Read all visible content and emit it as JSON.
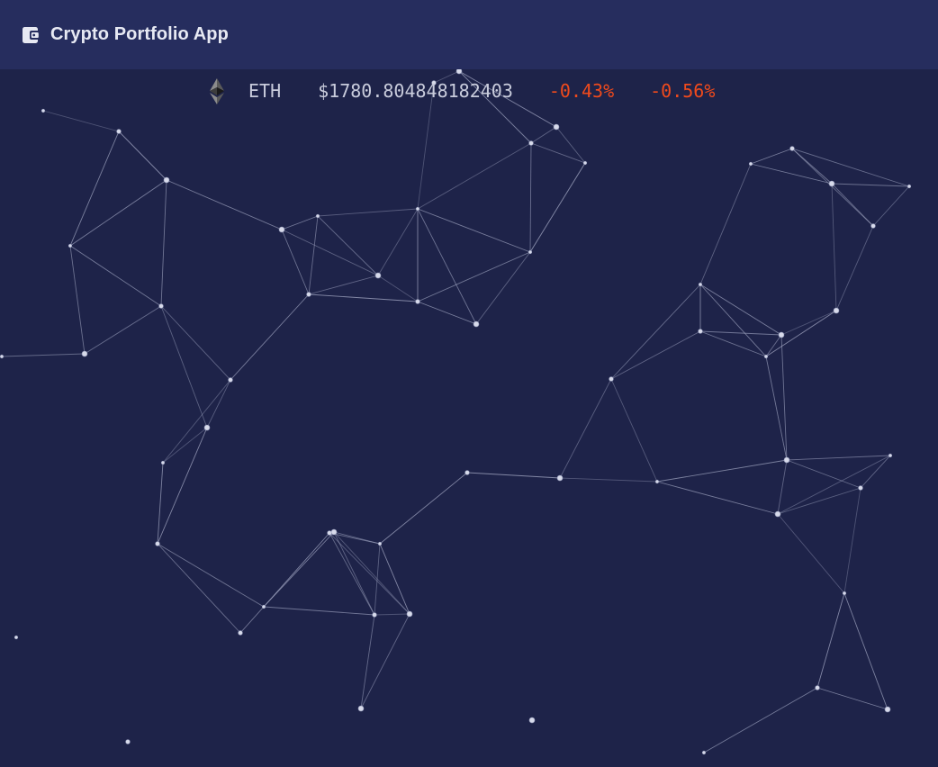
{
  "app": {
    "title": "Crypto Portfolio App",
    "logo_icon": "wallet-icon"
  },
  "ticker": {
    "icon": "ethereum-icon",
    "symbol": "ETH",
    "price": "$1780.804848182403",
    "change_1": "-0.43%",
    "change_2": "-0.56%",
    "change_color": "#f04a1c"
  },
  "colors": {
    "background": "#1e2349",
    "header": "#262d5e",
    "network_line": "#a7acc7",
    "network_node": "#d7daea"
  }
}
